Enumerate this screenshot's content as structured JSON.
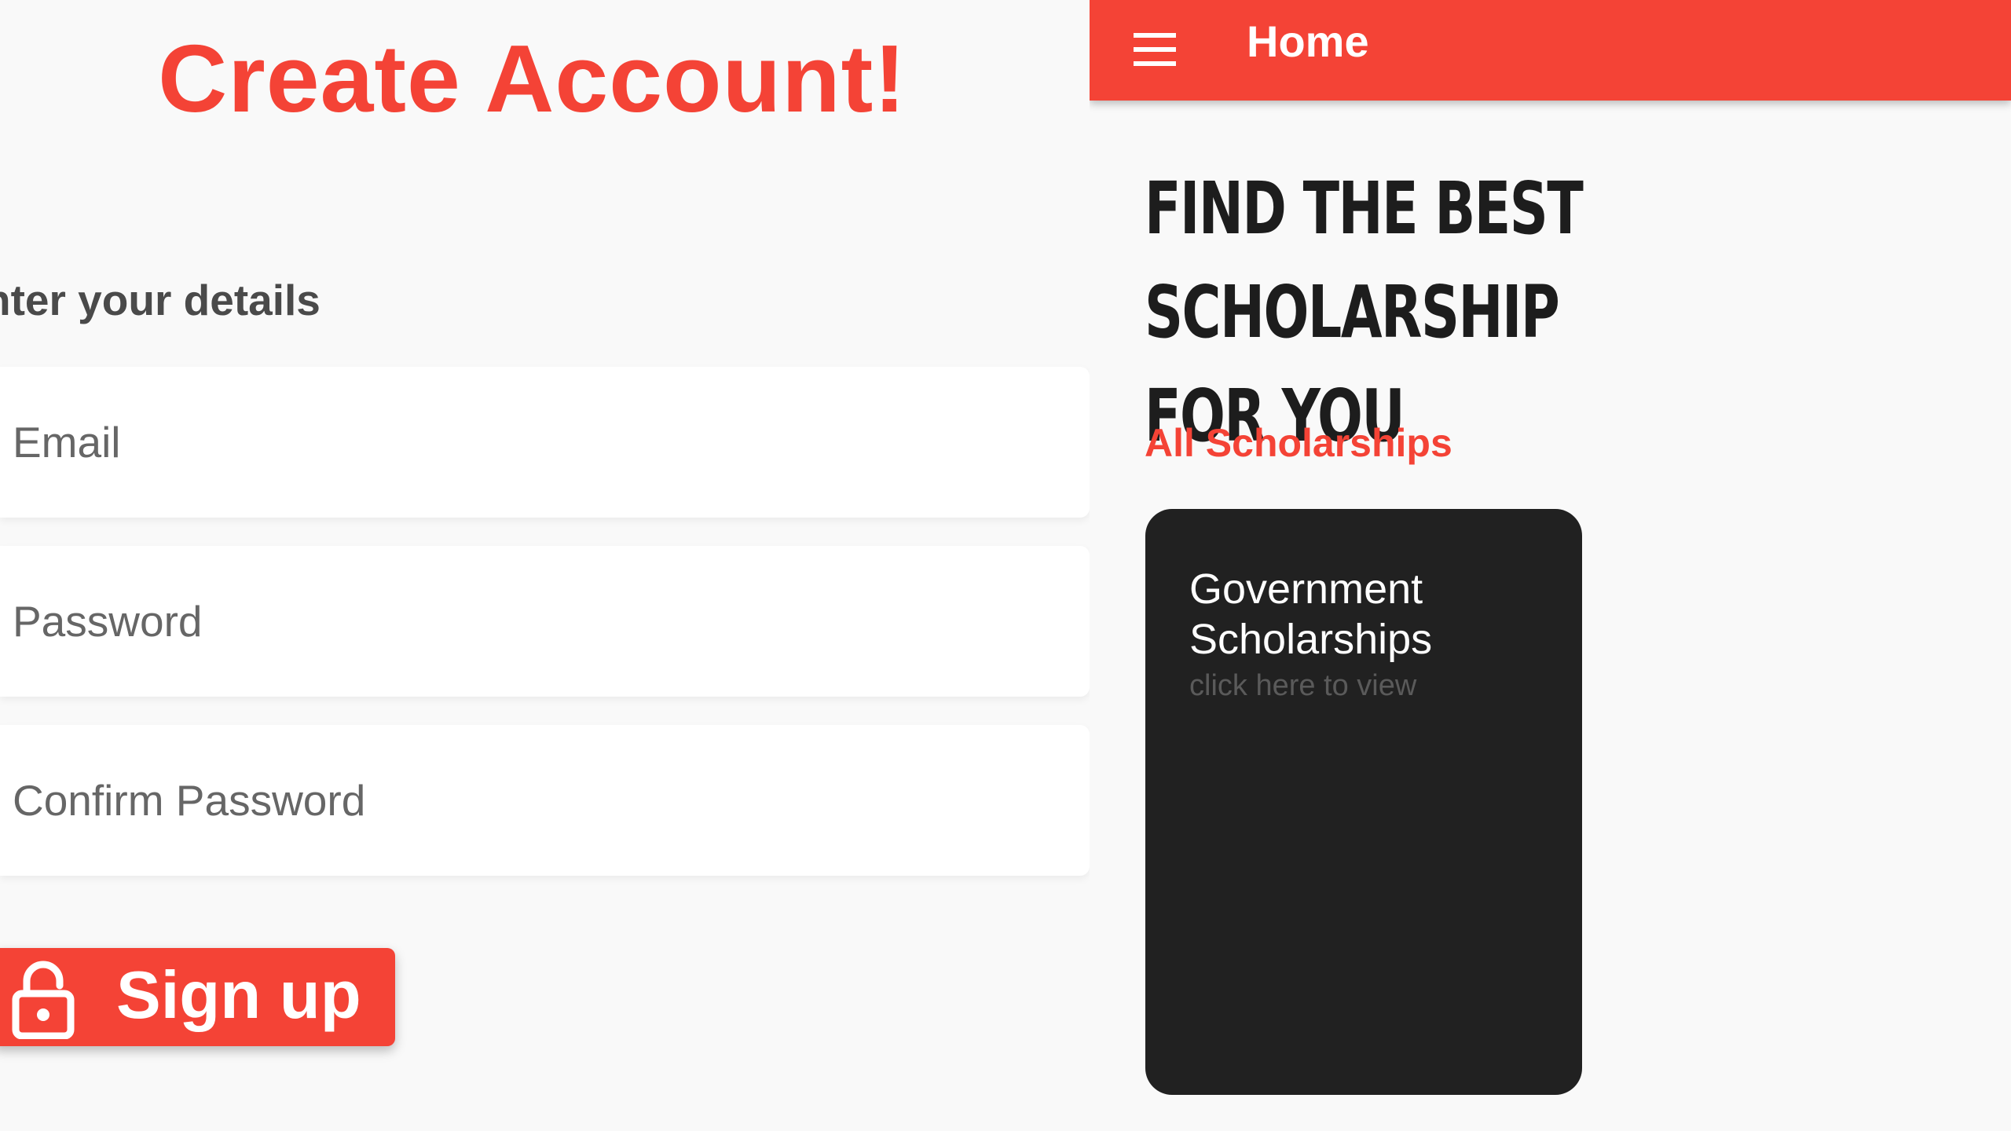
{
  "signup": {
    "title": "Create Account!",
    "subtitle": "nter your details",
    "email_placeholder": "Email",
    "password_placeholder": "Password",
    "confirm_placeholder": "Confirm Password",
    "button_label": "Sign up",
    "icon": "lock-icon"
  },
  "home": {
    "appbar_title": "Home",
    "menu_icon": "menu-icon",
    "headline_line1": "FIND THE BEST SCHOLARSHIP",
    "headline_line2": "FOR YOU",
    "section_label": "All Scholarships",
    "cards": [
      {
        "title": "Government Scholarships",
        "subtitle": "click here to view"
      }
    ]
  },
  "colors": {
    "accent": "#f44336",
    "background": "#f9f9f9",
    "card": "#212121",
    "headline": "#1d1d1d"
  }
}
